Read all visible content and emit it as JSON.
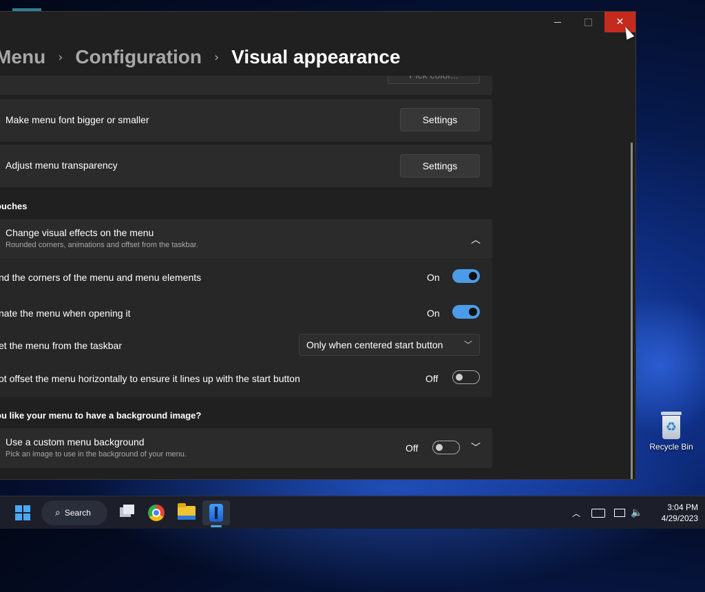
{
  "window": {
    "breadcrumb": [
      "Start Menu",
      "Configuration",
      "Visual appearance"
    ],
    "breadcrumb_visible": [
      "t Menu",
      "Configuration",
      "Visual appearance"
    ],
    "separator": "›",
    "controls": {
      "minimize": "minimize",
      "maximize": "maximize",
      "close": "✕"
    }
  },
  "main": {
    "top_partial_button": "Pick color...",
    "font_size": {
      "title": "Make menu font bigger or smaller",
      "button": "Settings"
    },
    "transparency": {
      "title": "Adjust menu transparency",
      "button": "Settings"
    },
    "section_touches": "ouches",
    "visual_effects": {
      "title": "Change visual effects on the menu",
      "subtitle": "Rounded corners, animations and offset from the taskbar."
    },
    "round_corners": {
      "label": "nd the corners of the menu and menu elements",
      "state": "On"
    },
    "animate": {
      "label": "nate the menu when opening it",
      "state": "On"
    },
    "offset": {
      "label": "et the menu from the taskbar",
      "value": "Only when centered start button"
    },
    "no_h_offset": {
      "label": "ot offset the menu horizontally to ensure it lines up with the start button",
      "state": "Off"
    },
    "section_background": "ou like your menu to have a background image?",
    "custom_bg": {
      "title": "Use a custom menu background",
      "subtitle": "Pick an image to use in the background of your menu.",
      "state": "Off"
    }
  },
  "desktop": {
    "recycle_bin_label": "Recycle Bin"
  },
  "taskbar": {
    "search_label": "Search",
    "time": "3:04 PM",
    "date": "4/29/2023"
  },
  "colors": {
    "accent": "#4c9be8",
    "close_button": "#c42b1c",
    "card": "#2b2b2b",
    "window_bg": "#202020"
  },
  "icons": [
    "windows-start-icon",
    "search-icon",
    "task-view-icon",
    "chrome-icon",
    "file-explorer-icon",
    "startallback-icon",
    "chevron-up-icon",
    "keyboard-icon",
    "network-icon",
    "volume-icon",
    "recycle-bin-icon"
  ]
}
